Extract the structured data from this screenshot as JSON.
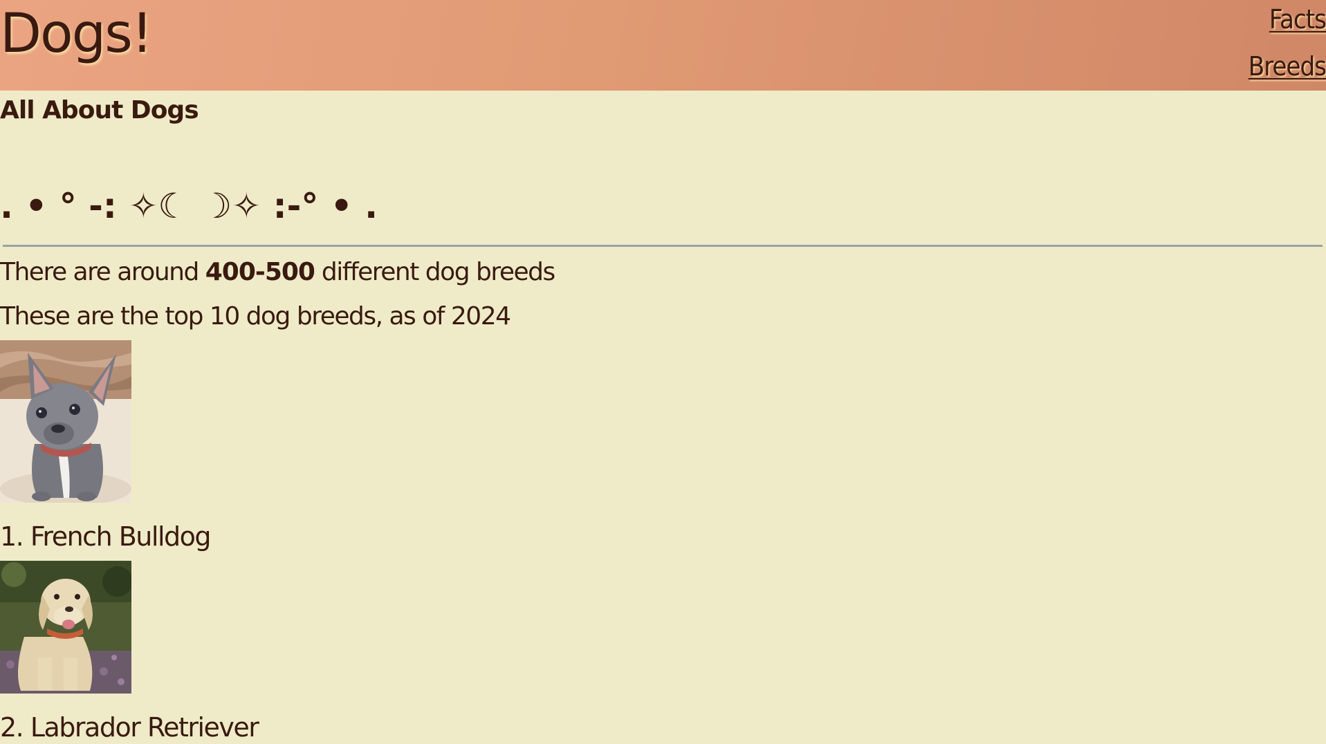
{
  "header": {
    "title": "Dogs!",
    "nav": [
      {
        "label": "Facts"
      },
      {
        "label": "Breeds"
      }
    ]
  },
  "main": {
    "subtitle": "All About Dogs",
    "decoration": ". • ° -: ✧☾ ☽✧ :-° • .",
    "intro_prefix": "There are around ",
    "intro_bold": "400-500",
    "intro_suffix": " different dog breeds",
    "top10_text": "These are the top 10 dog breeds, as of 2024",
    "breeds": [
      {
        "label": "1. French Bulldog",
        "image_icon": "french-bulldog-photo"
      },
      {
        "label": "2. Labrador Retriever",
        "image_icon": "labrador-retriever-photo"
      }
    ]
  },
  "colors": {
    "background": "#efebc8",
    "header_gradient_start": "#eaa482",
    "header_gradient_end": "#d08766",
    "text": "#3a1a10",
    "rule": "#98a3a3"
  }
}
